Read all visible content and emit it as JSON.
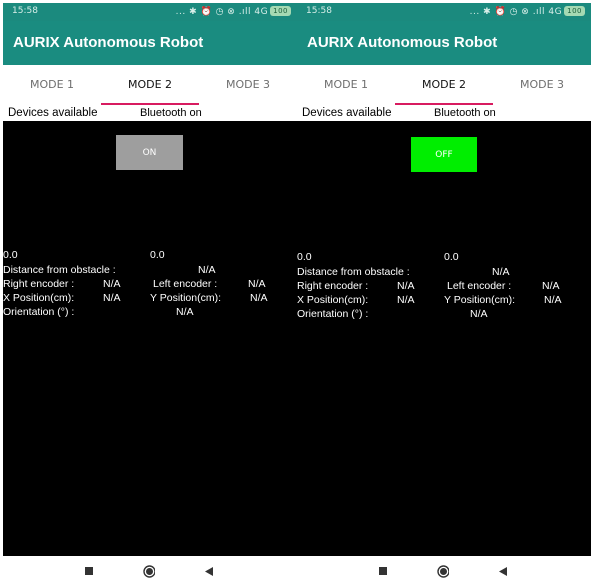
{
  "screens": [
    {
      "status": {
        "time": "15:58",
        "icons": "... ✱ ⏰ ◷ ⊗ .ıll 4G",
        "battery": "100"
      },
      "app_title": "AURIX Autonomous Robot",
      "tabs": [
        "MODE 1",
        "MODE 2",
        "MODE 3"
      ],
      "active_tab": "MODE 2",
      "devices_label": "Devices available",
      "bluetooth_status": "Bluetooth on",
      "toggle_label": "ON",
      "toggle_color": "#9e9e9e",
      "value_a": "0.0",
      "value_b": "0.0",
      "distance_label": "Distance from obstacle :",
      "distance_value": "N/A",
      "right_encoder_label": "Right encoder :",
      "right_encoder_value": "N/A",
      "left_encoder_label": "Left encoder :",
      "left_encoder_value": "N/A",
      "x_position_label": "X Position(cm):",
      "x_position_value": "N/A",
      "y_position_label": "Y Position(cm):",
      "y_position_value": "N/A",
      "orientation_label": "Orientation (°) :",
      "orientation_value": "N/A"
    },
    {
      "status": {
        "time": "15:58",
        "icons": "... ✱ ⏰ ◷ ⊗ .ıll 4G",
        "battery": "100"
      },
      "app_title": "AURIX Autonomous Robot",
      "tabs": [
        "MODE 1",
        "MODE 2",
        "MODE 3"
      ],
      "active_tab": "MODE 2",
      "devices_label": "Devices available",
      "bluetooth_status": "Bluetooth on",
      "toggle_label": "OFF",
      "toggle_color": "#00ee00",
      "value_a": "0.0",
      "value_b": "0.0",
      "distance_label": "Distance from obstacle :",
      "distance_value": "N/A",
      "right_encoder_label": "Right encoder :",
      "right_encoder_value": "N/A",
      "left_encoder_label": "Left encoder :",
      "left_encoder_value": "N/A",
      "x_position_label": "X Position(cm):",
      "x_position_value": "N/A",
      "y_position_label": "Y Position(cm):",
      "y_position_value": "N/A",
      "orientation_label": "Orientation (°) :",
      "orientation_value": "N/A"
    }
  ],
  "colors": {
    "status_bar": "#1b8a7e",
    "app_bar": "#1a8c80",
    "tab_indicator": "#d81b60",
    "background": "#000000"
  },
  "nav_icons": [
    "recent-apps-icon",
    "home-icon",
    "back-icon"
  ]
}
